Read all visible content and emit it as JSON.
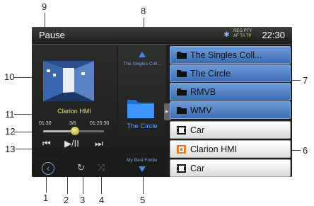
{
  "callouts": [
    "9",
    "10",
    "11",
    "12",
    "13",
    "1",
    "2",
    "3",
    "4",
    "5",
    "6",
    "7",
    "8"
  ],
  "status": {
    "mode": "Pause",
    "time": "22:30",
    "rds_top": "REG PTY",
    "rds_af": "AF",
    "rds_ta": "TA",
    "rds_tp": "TP",
    "bluetooth_icon": "bluetooth-icon"
  },
  "player": {
    "track_title": "Clarion HMI",
    "elapsed": "01:30",
    "track_position": "3/6",
    "total": "01:25:30",
    "progress_fraction": 0.52,
    "prev_icon": "⏮",
    "play_pause_icon": "▶/II",
    "next_icon": "⏭"
  },
  "bottom": {
    "back_icon": "‹",
    "repeat_icon": "↻",
    "shuffle_icon": "⤨"
  },
  "middle": {
    "prev_folder": "The Singles Coll...",
    "current_folder": "The Circle",
    "next_folder": "My Best Folder"
  },
  "list": {
    "items": [
      {
        "label": "The Singles Coll...",
        "type": "folder"
      },
      {
        "label": "The Circle",
        "type": "folder"
      },
      {
        "label": "RMVB",
        "type": "folder"
      },
      {
        "label": "WMV",
        "type": "folder"
      },
      {
        "label": "Car",
        "type": "video"
      },
      {
        "label": "Clarion HMI",
        "type": "audio"
      },
      {
        "label": "Car",
        "type": "video"
      }
    ]
  }
}
